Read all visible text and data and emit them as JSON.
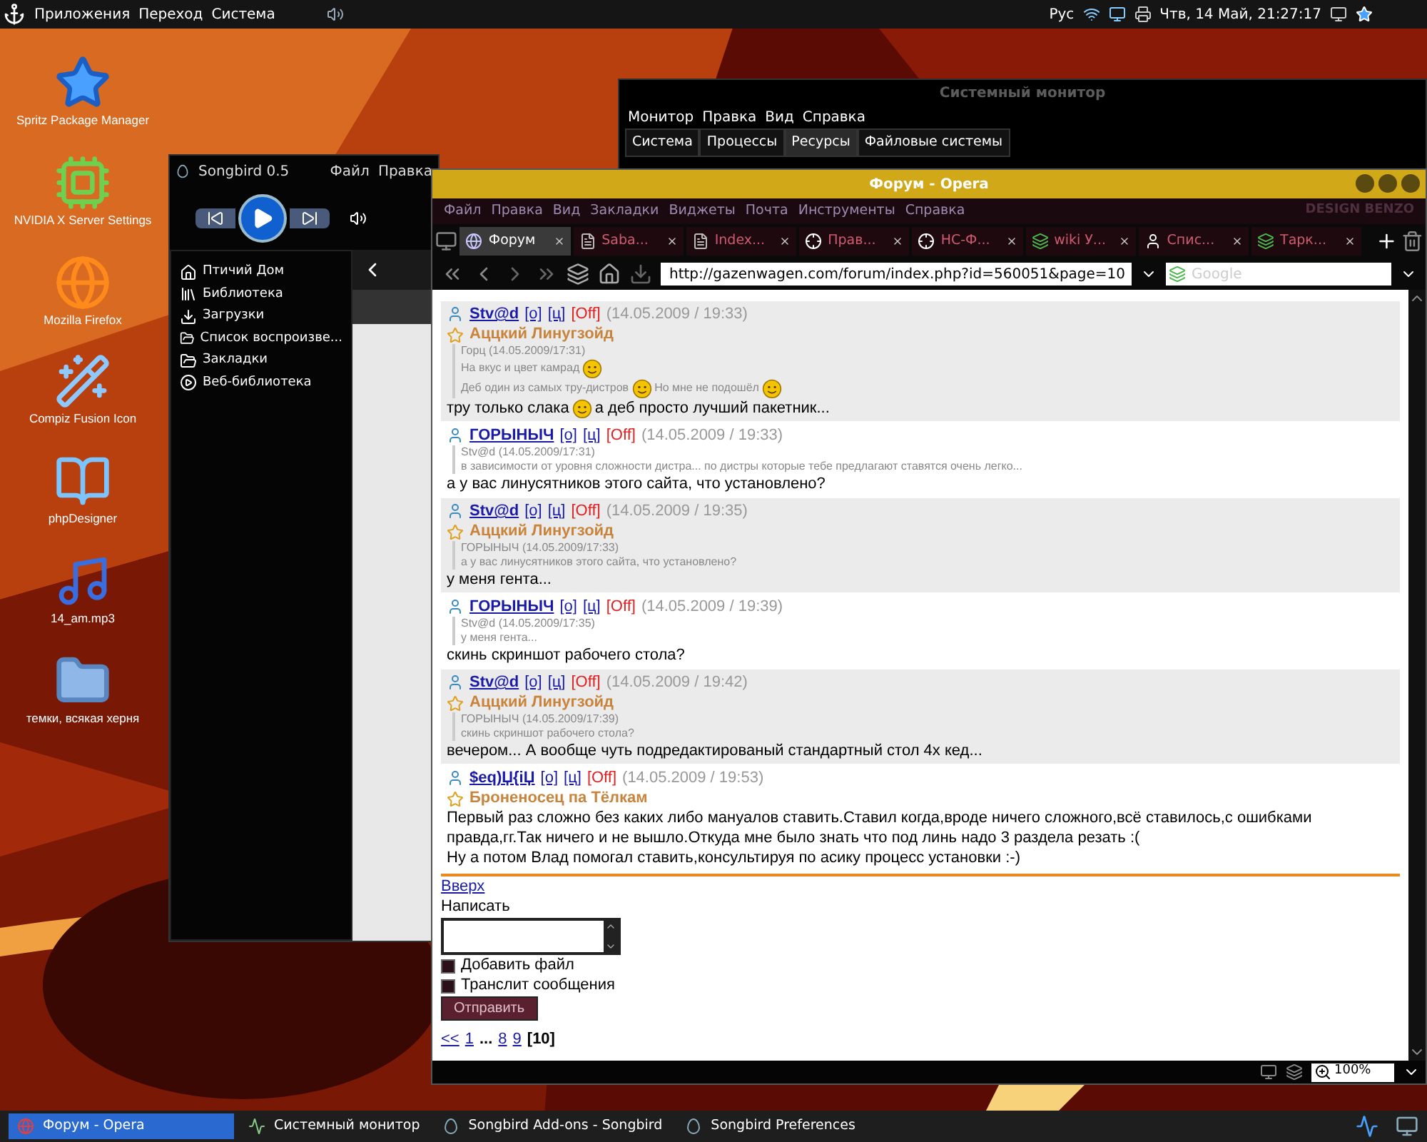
{
  "top_panel": {
    "menus": [
      "Приложения",
      "Переход",
      "Система"
    ],
    "keyboard_layout": "Рус",
    "clock": "Чтв, 14 Май, 21:27:17"
  },
  "desktop_icons": [
    {
      "label": "Spritz Package Manager",
      "kind": "star"
    },
    {
      "label": "NVIDIA X Server Settings",
      "kind": "board"
    },
    {
      "label": "Mozilla Firefox",
      "kind": "globe"
    },
    {
      "label": "Compiz Fusion Icon",
      "kind": "wand"
    },
    {
      "label": "phpDesigner",
      "kind": "book"
    },
    {
      "label": "14_am.mp3",
      "kind": "music"
    },
    {
      "label": "темки, всякая херня",
      "kind": "folder"
    }
  ],
  "system_monitor": {
    "title": "Системный монитор",
    "menu": [
      "Монитор",
      "Правка",
      "Вид",
      "Справка"
    ],
    "tabs": [
      {
        "label": "Система",
        "selected": false
      },
      {
        "label": "Процессы",
        "selected": false
      },
      {
        "label": "Ресурсы",
        "selected": true
      },
      {
        "label": "Файловые системы",
        "selected": false
      }
    ]
  },
  "songbird": {
    "title": "Songbird 0.5",
    "menu": [
      "Файл",
      "Правка"
    ],
    "sidebar": [
      {
        "label": "Птичий Дом",
        "kind": "home"
      },
      {
        "label": "Библиотека",
        "kind": "library"
      },
      {
        "label": "Загрузки",
        "kind": "download"
      },
      {
        "label": "Список воспроизве...",
        "kind": "folder"
      },
      {
        "label": "Закладки",
        "kind": "folder"
      },
      {
        "label": "Веб-библиотека",
        "kind": "web"
      }
    ]
  },
  "opera": {
    "title": "Форум - Opera",
    "menu": [
      "Файл",
      "Правка",
      "Вид",
      "Закладки",
      "Виджеты",
      "Почта",
      "Инструменты",
      "Справка"
    ],
    "skin_caption": "DESIGN BENZO",
    "tabs": [
      {
        "label": "Форум",
        "selected": true,
        "kind": "globe"
      },
      {
        "label": "Saba...",
        "selected": false,
        "kind": "doc"
      },
      {
        "label": "Index...",
        "selected": false,
        "kind": "doc"
      },
      {
        "label": "Прав...",
        "selected": false,
        "kind": "target"
      },
      {
        "label": "НС-Ф...",
        "selected": false,
        "kind": "target"
      },
      {
        "label": "wiki У...",
        "selected": false,
        "kind": "google"
      },
      {
        "label": "Спис...",
        "selected": false,
        "kind": "person"
      },
      {
        "label": "Тарк...",
        "selected": false,
        "kind": "google"
      }
    ],
    "address": "http://gazenwagen.com/forum/index.php?id=560051&page=10",
    "search": {
      "placeholder": "Google"
    },
    "posts": [
      {
        "author": "Stv@d",
        "links": [
          "[о]",
          "[ц]"
        ],
        "status": "[Off]",
        "date": "(14.05.2009 / 19:33)",
        "rank": "Аццкий Линугзойд",
        "shaded": true,
        "quote": {
          "author": "Горц (14.05.2009/17:31)",
          "lines": [
            [
              {
                "kind": "text",
                "text": "На вкус и цвет камрад"
              },
              {
                "kind": "smiley"
              }
            ],
            [
              {
                "kind": "text",
                "text": "Деб один из самых тру-дистров"
              },
              {
                "kind": "smiley"
              },
              {
                "kind": "text",
                "text": "Но мне не подошёл"
              },
              {
                "kind": "smiley"
              }
            ]
          ]
        },
        "body": [
          [
            {
              "kind": "text",
              "text": "тру только слака"
            },
            {
              "kind": "smiley"
            },
            {
              "kind": "text",
              "text": "а деб просто лучший пакетник..."
            }
          ]
        ]
      },
      {
        "author": "ГОРЫНЫЧ",
        "links": [
          "[о]",
          "[ц]"
        ],
        "status": "[Off]",
        "date": "(14.05.2009 / 19:33)",
        "shaded": false,
        "quote": {
          "author": "Stv@d (14.05.2009/17:31)",
          "lines": [
            [
              {
                "kind": "text",
                "text": "в зависимости от уровня сложности дистра... по дистры которые тебе предлагают ставятся очень легко..."
              }
            ]
          ]
        },
        "body": [
          [
            {
              "kind": "text",
              "text": "а у вас линусятников этого сайта, что установлено?"
            }
          ]
        ]
      },
      {
        "author": "Stv@d",
        "links": [
          "[о]",
          "[ц]"
        ],
        "status": "[Off]",
        "date": "(14.05.2009 / 19:35)",
        "rank": "Аццкий Линугзойд",
        "shaded": true,
        "quote": {
          "author": "ГОРЫНЫЧ (14.05.2009/17:33)",
          "lines": [
            [
              {
                "kind": "text",
                "text": "а у вас линусятников этого сайта, что установлено?"
              }
            ]
          ]
        },
        "body": [
          [
            {
              "kind": "text",
              "text": "у меня гента..."
            }
          ]
        ]
      },
      {
        "author": "ГОРЫНЫЧ",
        "links": [
          "[о]",
          "[ц]"
        ],
        "status": "[Off]",
        "date": "(14.05.2009 / 19:39)",
        "shaded": false,
        "quote": {
          "author": "Stv@d (14.05.2009/17:35)",
          "lines": [
            [
              {
                "kind": "text",
                "text": "у меня гента..."
              }
            ]
          ]
        },
        "body": [
          [
            {
              "kind": "text",
              "text": "скинь скриншот рабочего стола?"
            }
          ]
        ]
      },
      {
        "author": "Stv@d",
        "links": [
          "[о]",
          "[ц]"
        ],
        "status": "[Off]",
        "date": "(14.05.2009 / 19:42)",
        "rank": "Аццкий Линугзойд",
        "shaded": true,
        "quote": {
          "author": "ГОРЫНЫЧ (14.05.2009/17:39)",
          "lines": [
            [
              {
                "kind": "text",
                "text": "скинь скриншот рабочего стола?"
              }
            ]
          ]
        },
        "body": [
          [
            {
              "kind": "text",
              "text": "вечером... А вообще чуть подредактированый стандартный стол 4х кед..."
            }
          ]
        ]
      },
      {
        "author": "$eq)Џ{іЏ",
        "links": [
          "[о]",
          "[ц]"
        ],
        "status": "[Off]",
        "date": "(14.05.2009 / 19:53)",
        "rank": "Броненосец па Тёлкам",
        "shaded": false,
        "body": [
          [
            {
              "kind": "text",
              "text": "Первый раз сложно без каких либо мануалов ставить.Ставил когда,вроде ничего сложного,всё ставилось,с ошибками правда,гг.Так ничего и не вышло.Откуда мне было знать что под линь надо 3 раздела резать :("
            }
          ],
          [
            {
              "kind": "text",
              "text": "Ну а потом Влад помогал ставить,консультируя по асику процесс установки :-)"
            }
          ]
        ]
      }
    ],
    "form": {
      "up_link": "Вверх",
      "label": "Написать",
      "checkboxes": [
        {
          "label": "Добавить файл",
          "checked": false
        },
        {
          "label": "Транслит сообщения",
          "checked": false
        }
      ],
      "submit": "Отправить"
    },
    "pager": [
      {
        "label": "<<",
        "kind": "link"
      },
      {
        "label": "1",
        "kind": "link"
      },
      {
        "label": "...",
        "kind": "gap"
      },
      {
        "label": "8",
        "kind": "link"
      },
      {
        "label": "9",
        "kind": "link"
      },
      {
        "label": "[10]",
        "kind": "current"
      }
    ],
    "zoom": "100%"
  },
  "taskbar": [
    {
      "label": "Форум - Opera",
      "selected": true,
      "kind": "opera"
    },
    {
      "label": "Системный монитор",
      "selected": false,
      "kind": "monitor"
    },
    {
      "label": "Songbird Add-ons - Songbird",
      "selected": false,
      "kind": "bird"
    },
    {
      "label": "Songbird Preferences",
      "selected": false,
      "kind": "bird"
    }
  ]
}
